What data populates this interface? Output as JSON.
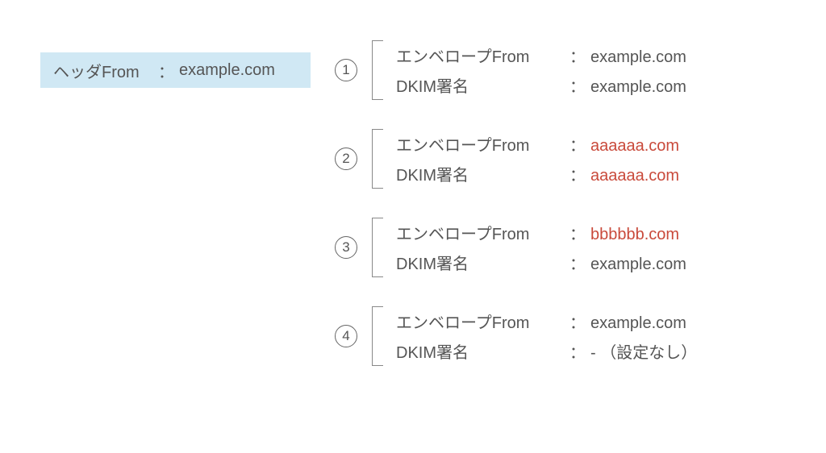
{
  "header": {
    "label": "ヘッダFrom",
    "colon": "：",
    "value": "example.com"
  },
  "labels": {
    "envelopeFrom": "エンベロープFrom",
    "dkim": "DKIM署名",
    "colon": "："
  },
  "cases": [
    {
      "num": "1",
      "envelope": {
        "value": "example.com",
        "mismatch": false
      },
      "dkim": {
        "value": "example.com",
        "mismatch": false
      }
    },
    {
      "num": "2",
      "envelope": {
        "value": "aaaaaa.com",
        "mismatch": true
      },
      "dkim": {
        "value": "aaaaaa.com",
        "mismatch": true
      }
    },
    {
      "num": "3",
      "envelope": {
        "value": "bbbbbb.com",
        "mismatch": true
      },
      "dkim": {
        "value": "example.com",
        "mismatch": false
      }
    },
    {
      "num": "4",
      "envelope": {
        "value": "example.com",
        "mismatch": false
      },
      "dkim": {
        "value": " - （設定なし）",
        "mismatch": false
      }
    }
  ]
}
